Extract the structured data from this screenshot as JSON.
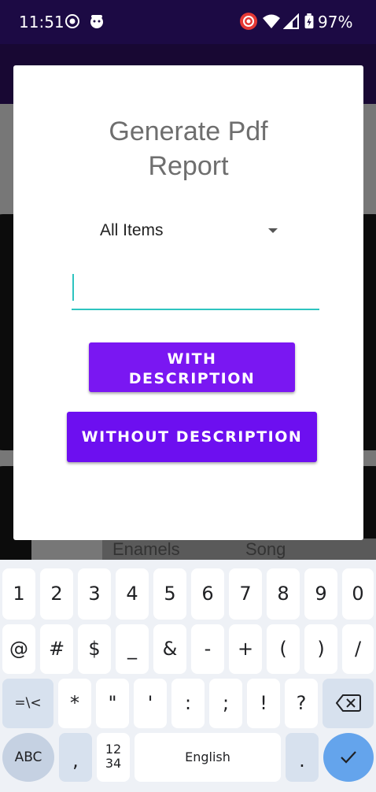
{
  "status_bar": {
    "time": "11:51",
    "battery": "97%",
    "icons": [
      "record-icon",
      "face-icon",
      "cast-icon",
      "wifi-icon",
      "signal-icon",
      "battery-icon"
    ]
  },
  "background": {
    "labels": [
      "Enamels",
      "Song"
    ]
  },
  "dialog": {
    "title_line1": "Generate Pdf",
    "title_line2": "Report",
    "spinner_value": "All Items",
    "text_input_value": "",
    "btn_with_line1": "WITH",
    "btn_with_line2": "DESCRIPTION",
    "btn_without": "WITHOUT DESCRIPTION"
  },
  "keyboard": {
    "row1": [
      "1",
      "2",
      "3",
      "4",
      "5",
      "6",
      "7",
      "8",
      "9",
      "0"
    ],
    "row2": [
      "@",
      "#",
      "$",
      "_",
      "&",
      "-",
      "+",
      "(",
      ")",
      "/"
    ],
    "row3": [
      "=\\<",
      "*",
      "\"",
      "'",
      ":",
      ";",
      "!",
      "?"
    ],
    "abc": "ABC",
    "comma": ",",
    "num_top": "12",
    "num_bottom": "34",
    "space": "English",
    "period": "."
  },
  "colors": {
    "accent": "#7a17f2",
    "input_line": "#2ec4c0",
    "statusbar": "#1c0a44"
  }
}
